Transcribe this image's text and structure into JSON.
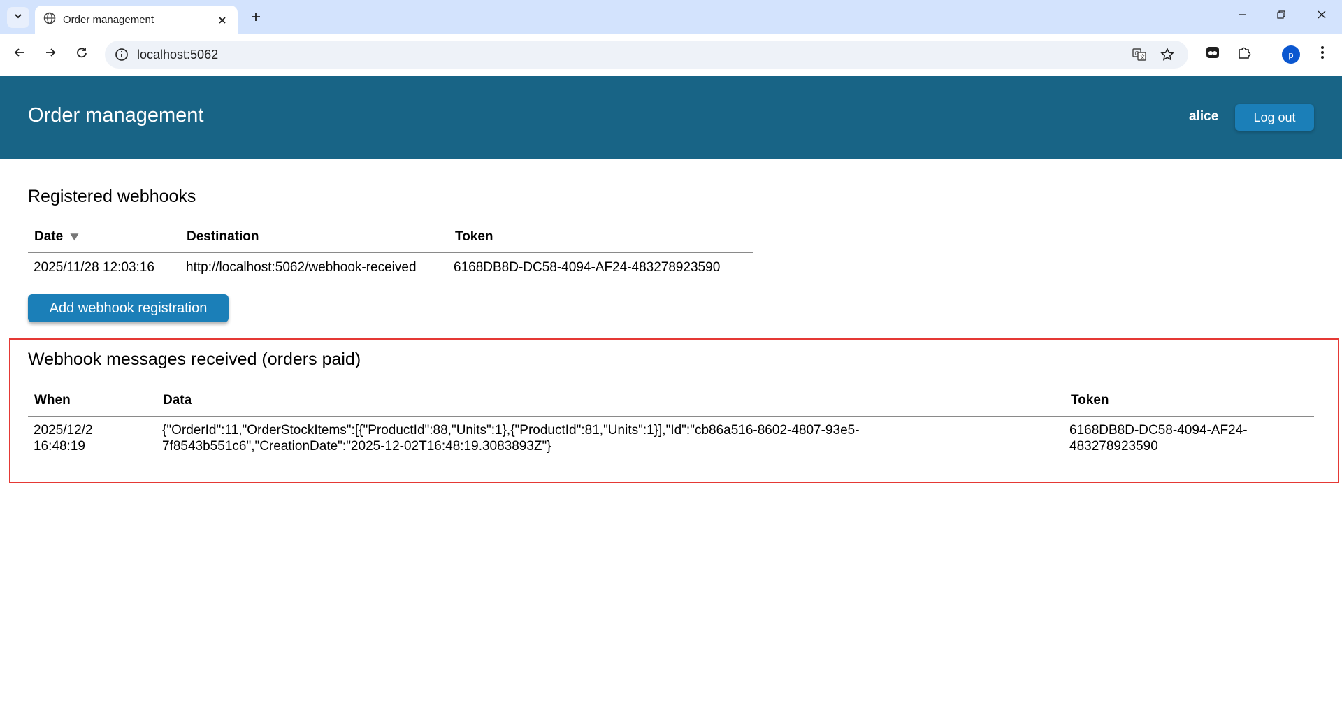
{
  "browser": {
    "tab_title": "Order management",
    "url": "localhost:5062",
    "profile_initial": "p",
    "icons": {
      "tab_search": "chevron-down-icon",
      "favicon": "globe-icon",
      "close": "close-icon",
      "new_tab": "plus-icon",
      "back": "arrow-left-icon",
      "forward": "arrow-right-icon",
      "reload": "reload-icon",
      "site_info": "info-icon",
      "translate": "translate-icon",
      "bookmark": "star-icon",
      "extension_app": "extension-app-icon",
      "extensions": "puzzle-icon",
      "menu": "kebab-menu-icon"
    }
  },
  "header": {
    "title": "Order management",
    "user": "alice",
    "logout_label": "Log out"
  },
  "webhooks": {
    "title": "Registered webhooks",
    "columns": {
      "date": "Date",
      "destination": "Destination",
      "token": "Token"
    },
    "sort_indicator": "▼",
    "rows": [
      {
        "date": "2025/11/28 12:03:16",
        "destination": "http://localhost:5062/webhook-received",
        "token": "6168DB8D-DC58-4094-AF24-483278923590"
      }
    ],
    "add_label": "Add webhook registration"
  },
  "messages": {
    "title": "Webhook messages received (orders paid)",
    "columns": {
      "when": "When",
      "data": "Data",
      "token": "Token"
    },
    "rows": [
      {
        "when_date": "2025/12/2",
        "when_time": "16:48:19",
        "data_line1": "{\"OrderId\":11,\"OrderStockItems\":[{\"ProductId\":88,\"Units\":1},{\"ProductId\":81,\"Units\":1}],\"Id\":\"cb86a516-8602-4807-93e5-",
        "data_line2": "7f8543b551c6\",\"CreationDate\":\"2025-12-02T16:48:19.3083893Z\"}",
        "token_line1": "6168DB8D-DC58-4094-AF24-",
        "token_line2": "483278923590"
      }
    ]
  },
  "colors": {
    "header_bg": "#186486",
    "button_bg": "#1b7fb8",
    "highlight_border": "#e53935",
    "tabstrip_bg": "#d3e3fd"
  }
}
